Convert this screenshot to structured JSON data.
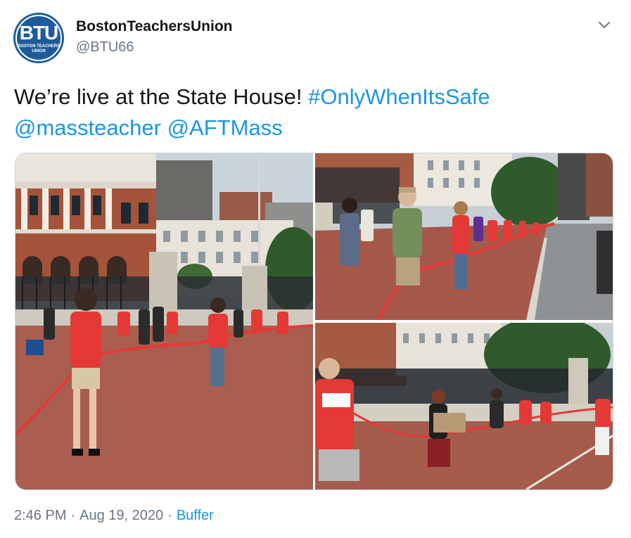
{
  "author": {
    "display_name": "BostonTeachersUnion",
    "handle": "@BTU66",
    "avatar_letters": "BTU",
    "avatar_subtext": "BOSTON TEACHERS UNION"
  },
  "tweet": {
    "text_plain": "We’re live at the State House! ",
    "hashtag": "#OnlyWhenItsSafe",
    "mention_1": "@massteacher",
    "mention_2": "@AFTMass"
  },
  "media": {
    "photo_count": 3,
    "photos": [
      {
        "icon": "photo-state-house-protest"
      },
      {
        "icon": "photo-sidewalk-line"
      },
      {
        "icon": "photo-fence-signs"
      }
    ]
  },
  "footer": {
    "time": "2:46 PM",
    "separator": "·",
    "date": "Aug 19, 2020",
    "source": "Buffer"
  },
  "colors": {
    "link": "#1b95e0",
    "text": "#14171a",
    "muted": "#657786",
    "avatar_bg": "#1f5a9c"
  },
  "icons": {
    "caret": "chevron-down-icon"
  }
}
